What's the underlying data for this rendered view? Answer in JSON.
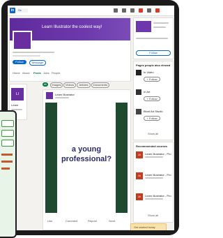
{
  "top_nav": {
    "search_hint": "Se",
    "icons": [
      "home-icon",
      "network-icon",
      "jobs-icon",
      "messaging-icon",
      "notifications-icon",
      "profile-icon"
    ]
  },
  "profile": {
    "banner_text": "Learn Illustrator the coolest way!",
    "follow_label": "Follow",
    "message_label": "Message",
    "tabs": [
      "Home",
      "About",
      "Posts",
      "Jobs",
      "People"
    ],
    "active_tab": "Posts"
  },
  "left_card": {
    "logo_text": "LI",
    "lines": [
      "Learn"
    ]
  },
  "filters": [
    "All",
    "Images",
    "Videos",
    "Articles",
    "Documents"
  ],
  "post": {
    "author": "Learn Illustrator",
    "video_text": "a young professional?",
    "actions": [
      "Like",
      "Comment",
      "Repost",
      "Send"
    ]
  },
  "right_panel": {
    "follow_label": "Follow",
    "pages_heading": "Pages people also viewed",
    "pages": [
      {
        "name": "In Video",
        "action": "+ Follow"
      },
      {
        "name": "In Art",
        "action": "+ Follow"
      },
      {
        "name": "Blunt Art Studio",
        "action": "+ Follow"
      }
    ],
    "show_all": "Show all",
    "courses_heading": "Recommended courses",
    "courses": [
      {
        "logo": "Ai",
        "title": "Learn Illustrator - Pro"
      },
      {
        "logo": "Ai",
        "title": "Learn Illustrator - Pro"
      },
      {
        "logo": "Ai",
        "title": "Learn Illustrator - Pro"
      }
    ],
    "show_all_2": "Show all",
    "ad_text": "Get started today"
  },
  "phone": {
    "items": [
      "",
      "",
      ""
    ]
  },
  "colors": {
    "banner": "#6c38ab",
    "brand": "#0a66c2",
    "accent_green": "#057642",
    "video_bg": "#1e4a2f",
    "illustrator_red": "#c63a1f"
  }
}
